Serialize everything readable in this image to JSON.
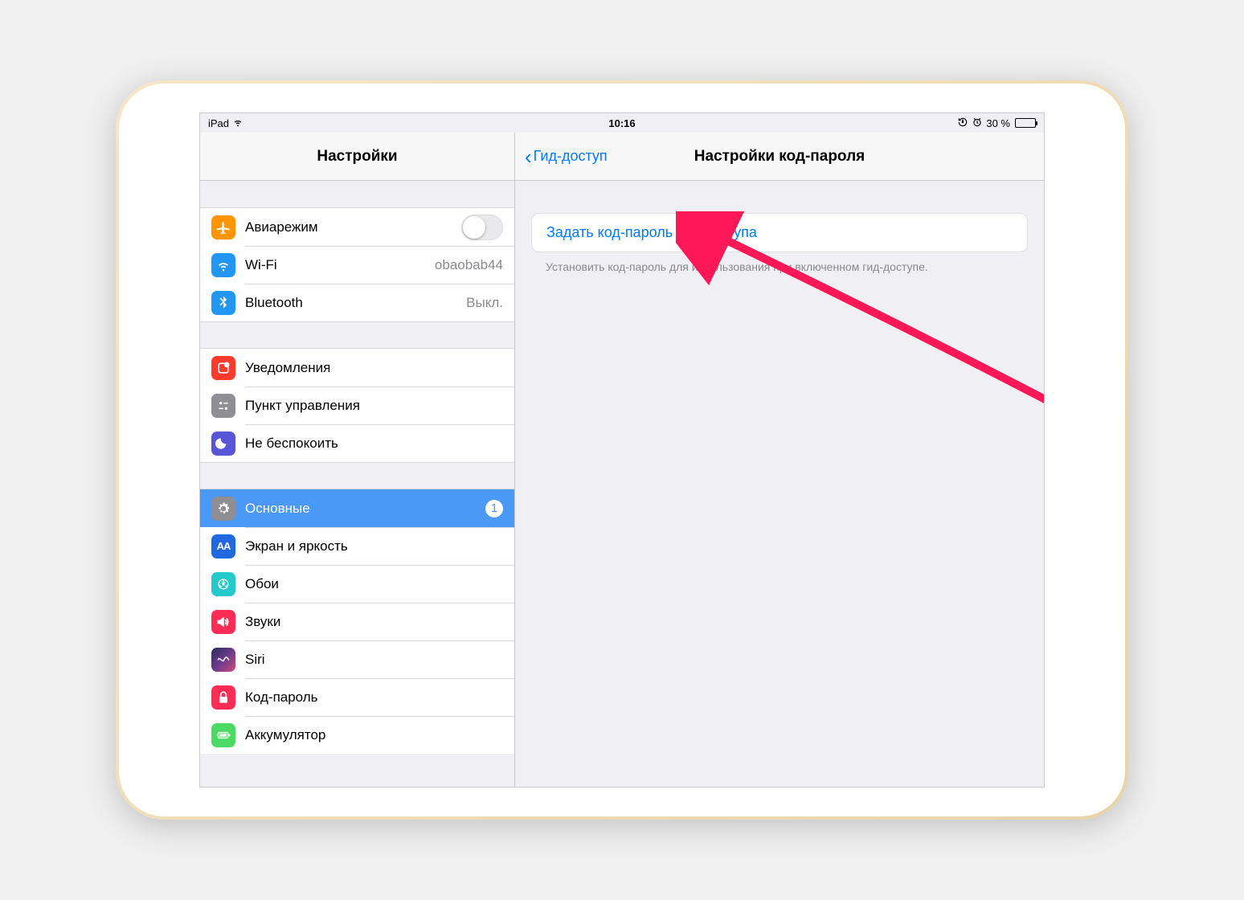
{
  "status": {
    "device": "iPad",
    "time": "10:16",
    "battery_text": "30 %"
  },
  "sidebar": {
    "title": "Настройки",
    "groups": [
      [
        {
          "id": "airplane",
          "label": "Авиарежим",
          "toggle": false
        },
        {
          "id": "wifi",
          "label": "Wi-Fi",
          "value": "obaobab44"
        },
        {
          "id": "bluetooth",
          "label": "Bluetooth",
          "value": "Выкл."
        }
      ],
      [
        {
          "id": "notifications",
          "label": "Уведомления"
        },
        {
          "id": "control_center",
          "label": "Пункт управления"
        },
        {
          "id": "dnd",
          "label": "Не беспокоить"
        }
      ],
      [
        {
          "id": "general",
          "label": "Основные",
          "badge": "1",
          "selected": true
        },
        {
          "id": "display",
          "label": "Экран и яркость"
        },
        {
          "id": "wallpaper",
          "label": "Обои"
        },
        {
          "id": "sounds",
          "label": "Звуки"
        },
        {
          "id": "siri",
          "label": "Siri"
        },
        {
          "id": "passcode",
          "label": "Код-пароль"
        },
        {
          "id": "battery",
          "label": "Аккумулятор"
        }
      ]
    ]
  },
  "detail": {
    "back_label": "Гид-доступ",
    "title": "Настройки код-пароля",
    "action_label": "Задать код-пароль гид-доступа",
    "footer": "Установить код-пароль для использования при включенном гид-доступе."
  }
}
